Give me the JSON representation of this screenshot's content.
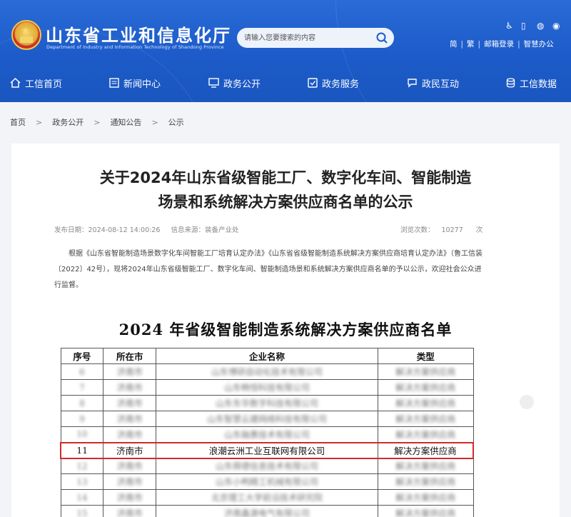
{
  "header": {
    "site_name": "山东省工业和信息化厅",
    "site_subtitle": "Department of Industry and Information Technology of Shandong Province",
    "search_placeholder": "请输入您要搜索的内容",
    "top_links": [
      "简",
      "繁",
      "邮箱登录",
      "智慧办公"
    ],
    "brand_color": "#1c5bc9"
  },
  "nav": {
    "items": [
      {
        "label": "工信首页",
        "icon": "home-icon"
      },
      {
        "label": "新闻中心",
        "icon": "news-icon"
      },
      {
        "label": "政务公开",
        "icon": "monitor-icon"
      },
      {
        "label": "政务服务",
        "icon": "service-icon"
      },
      {
        "label": "政民互动",
        "icon": "chat-icon"
      },
      {
        "label": "工信数据",
        "icon": "database-icon"
      }
    ]
  },
  "breadcrumb": [
    "首页",
    "政务公开",
    "通知公告",
    "公示"
  ],
  "article": {
    "title_line1": "关于2024年山东省级智能工厂、数字化车间、智能制造",
    "title_line2": "场景和系统解决方案供应商名单的公示",
    "publish_label": "发布日期：2024-08-12 14:00:26",
    "source_label": "信息来源：",
    "source_value": "装备产业处",
    "views_label": "浏览次数：",
    "views_value": "10277",
    "views_unit": "次",
    "intro": "根据《山东省智能制造场景数字化车间智能工厂培育认定办法》《山东省省级智能制造系统解决方案供应商培育认定办法》（鲁工信装〔2022〕42号），现将2024年山东省级智能工厂、数字化车间、智能制造场景和系统解决方案供应商名单的予以公示，欢迎社会公众进行监督。"
  },
  "document": {
    "title": "2024 年省级智能制造系统解决方案供应商名单",
    "table": {
      "headers": [
        "序号",
        "所在市",
        "企业名称",
        "类型"
      ],
      "rows": [
        {
          "no": "6",
          "city": "济南市",
          "company": "山东博研自动化技术有限公司",
          "type": "解决方案供应商",
          "blurred": true
        },
        {
          "no": "7",
          "city": "济南市",
          "company": "山东畅恒科技有限公司",
          "type": "解决方案供应商",
          "blurred": true
        },
        {
          "no": "8",
          "city": "济南市",
          "company": "山东东华数字科技有限公司",
          "type": "解决方案供应商",
          "blurred": true
        },
        {
          "no": "9",
          "city": "济南市",
          "company": "山东智慧云建网络科技有限公司",
          "type": "解决方案供应商",
          "blurred": true
        },
        {
          "no": "10",
          "city": "济南市",
          "company": "山东融惠技术有限公司",
          "type": "解决方案供应商",
          "blurred": true
        },
        {
          "no": "11",
          "city": "济南市",
          "company": "浪潮云洲工业互联网有限公司",
          "type": "解决方案供应商",
          "blurred": false
        },
        {
          "no": "12",
          "city": "济南市",
          "company": "山东舜德信息技术有限公司",
          "type": "解决方案供应商",
          "blurred": true
        },
        {
          "no": "13",
          "city": "济南市",
          "company": "山东小鸭精工机械有限公司",
          "type": "解决方案供应商",
          "blurred": true
        },
        {
          "no": "14",
          "city": "济南市",
          "company": "北京理工大学前沿技术研究院",
          "type": "解决方案供应商",
          "blurred": true
        },
        {
          "no": "15",
          "city": "济南市",
          "company": "济南鑫源电气有限公司",
          "type": "解决方案供应商",
          "blurred": true
        }
      ]
    }
  }
}
